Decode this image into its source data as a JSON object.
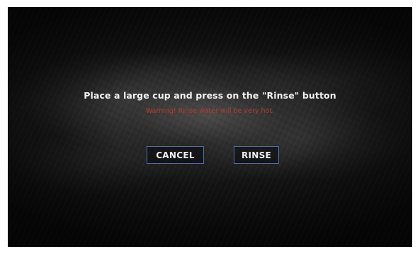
{
  "dialog": {
    "message": "Place a large cup and press on the \"Rinse\" button",
    "warning": "Warning! Rinse water will be very hot.",
    "warning_color": "#b83a2a"
  },
  "buttons": {
    "cancel_label": "CANCEL",
    "rinse_label": "RINSE",
    "border_color": "#4f6fa8"
  }
}
